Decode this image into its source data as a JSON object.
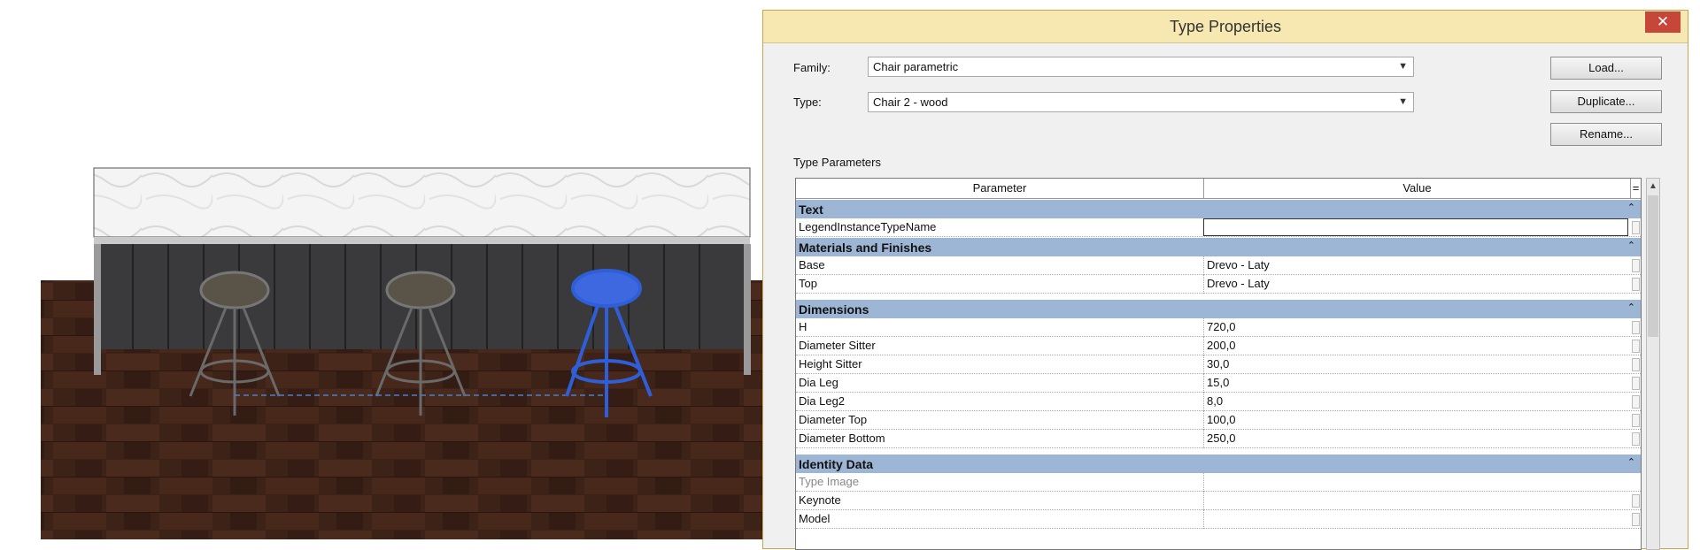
{
  "dialog": {
    "title": "Type Properties",
    "close_label": "✕",
    "family_label": "Family:",
    "family_value": "Chair parametric",
    "type_label": "Type:",
    "type_value": "Chair 2 - wood",
    "load_label": "Load...",
    "duplicate_label": "Duplicate...",
    "rename_label": "Rename...",
    "type_parameters_label": "Type Parameters"
  },
  "grid": {
    "col_parameter": "Parameter",
    "col_value": "Value",
    "col_equals": "=",
    "groups": [
      {
        "name": "Text",
        "rows": [
          {
            "param": "LegendInstanceTypeName",
            "value": ""
          }
        ]
      },
      {
        "name": "Materials and Finishes",
        "rows": [
          {
            "param": "Base",
            "value": "Drevo - Laty"
          },
          {
            "param": "Top",
            "value": "Drevo - Laty"
          }
        ]
      },
      {
        "name": "Dimensions",
        "rows": [
          {
            "param": "H",
            "value": "720,0"
          },
          {
            "param": "Diameter Sitter",
            "value": "200,0"
          },
          {
            "param": "Height Sitter",
            "value": "30,0"
          },
          {
            "param": "Dia Leg",
            "value": "15,0"
          },
          {
            "param": "Dia Leg2",
            "value": "8,0"
          },
          {
            "param": "Diameter Top",
            "value": "100,0"
          },
          {
            "param": "Diameter Bottom",
            "value": "250,0"
          }
        ]
      },
      {
        "name": "Identity Data",
        "rows": [
          {
            "param": "Type Image",
            "value": ""
          },
          {
            "param": "Keynote",
            "value": ""
          },
          {
            "param": "Model",
            "value": ""
          }
        ]
      }
    ],
    "collapse_icon": "⌃"
  },
  "colors": {
    "group_header": "#9eb6d6",
    "selected_stool": "#2f5fd8",
    "floor": "#3d2218",
    "titlebar": "#f7e7b0"
  }
}
